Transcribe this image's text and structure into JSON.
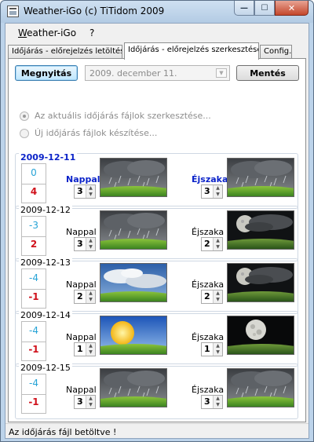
{
  "window": {
    "title": "Weather-iGo (c) TiTidom 2009",
    "min_glyph": "—",
    "max_glyph": "☐",
    "close_glyph": "✕"
  },
  "menu": {
    "items": [
      "Weather-iGo",
      "?"
    ]
  },
  "tabs": [
    {
      "label": "Időjárás - előrejelzés letöltése",
      "active": false
    },
    {
      "label": "Időjárás - előrejelzés szerkesztése",
      "active": true
    },
    {
      "label": "Config.",
      "active": false
    }
  ],
  "toolbar": {
    "open_label": "Megnyitás",
    "date_value": "2009.  december  11.",
    "save_label": "Mentés"
  },
  "options": {
    "edit_current": "Az aktuális időjárás fájlok szerkesztése...",
    "create_new": "Új időjárás fájlok készítése..."
  },
  "days": [
    {
      "date": "2009-12-11",
      "high": "0",
      "low": "4",
      "day_label": "Nappal",
      "day_value": "3",
      "night_label": "Éjszaka",
      "night_value": "3",
      "day_icon": "rain-cloud",
      "night_icon": "rain-cloud"
    },
    {
      "date": "2009-12-12",
      "high": "-3",
      "low": "2",
      "day_label": "Nappal",
      "day_value": "3",
      "night_label": "Éjszaka",
      "night_value": "2",
      "day_icon": "rain-cloud",
      "night_icon": "moon-cloud"
    },
    {
      "date": "2009-12-13",
      "high": "-4",
      "low": "-1",
      "day_label": "Nappal",
      "day_value": "2",
      "night_label": "Éjszaka",
      "night_value": "2",
      "day_icon": "cloudy-sky",
      "night_icon": "moon-cloud"
    },
    {
      "date": "2009-12-14",
      "high": "-4",
      "low": "-1",
      "day_label": "Nappal",
      "day_value": "1",
      "night_label": "Éjszaka",
      "night_value": "1",
      "day_icon": "sun",
      "night_icon": "moon"
    },
    {
      "date": "2009-12-15",
      "high": "-4",
      "low": "-1",
      "day_label": "Nappal",
      "day_value": "3",
      "night_label": "Éjszaka",
      "night_value": "3",
      "day_icon": "rain-cloud",
      "night_icon": "rain-cloud"
    }
  ],
  "status": {
    "text": "Az időjárás fájl betöltve !"
  },
  "colors": {
    "active_blue": "#0b23c9",
    "temp_high": "#26a3d6",
    "temp_low": "#d0111b"
  }
}
